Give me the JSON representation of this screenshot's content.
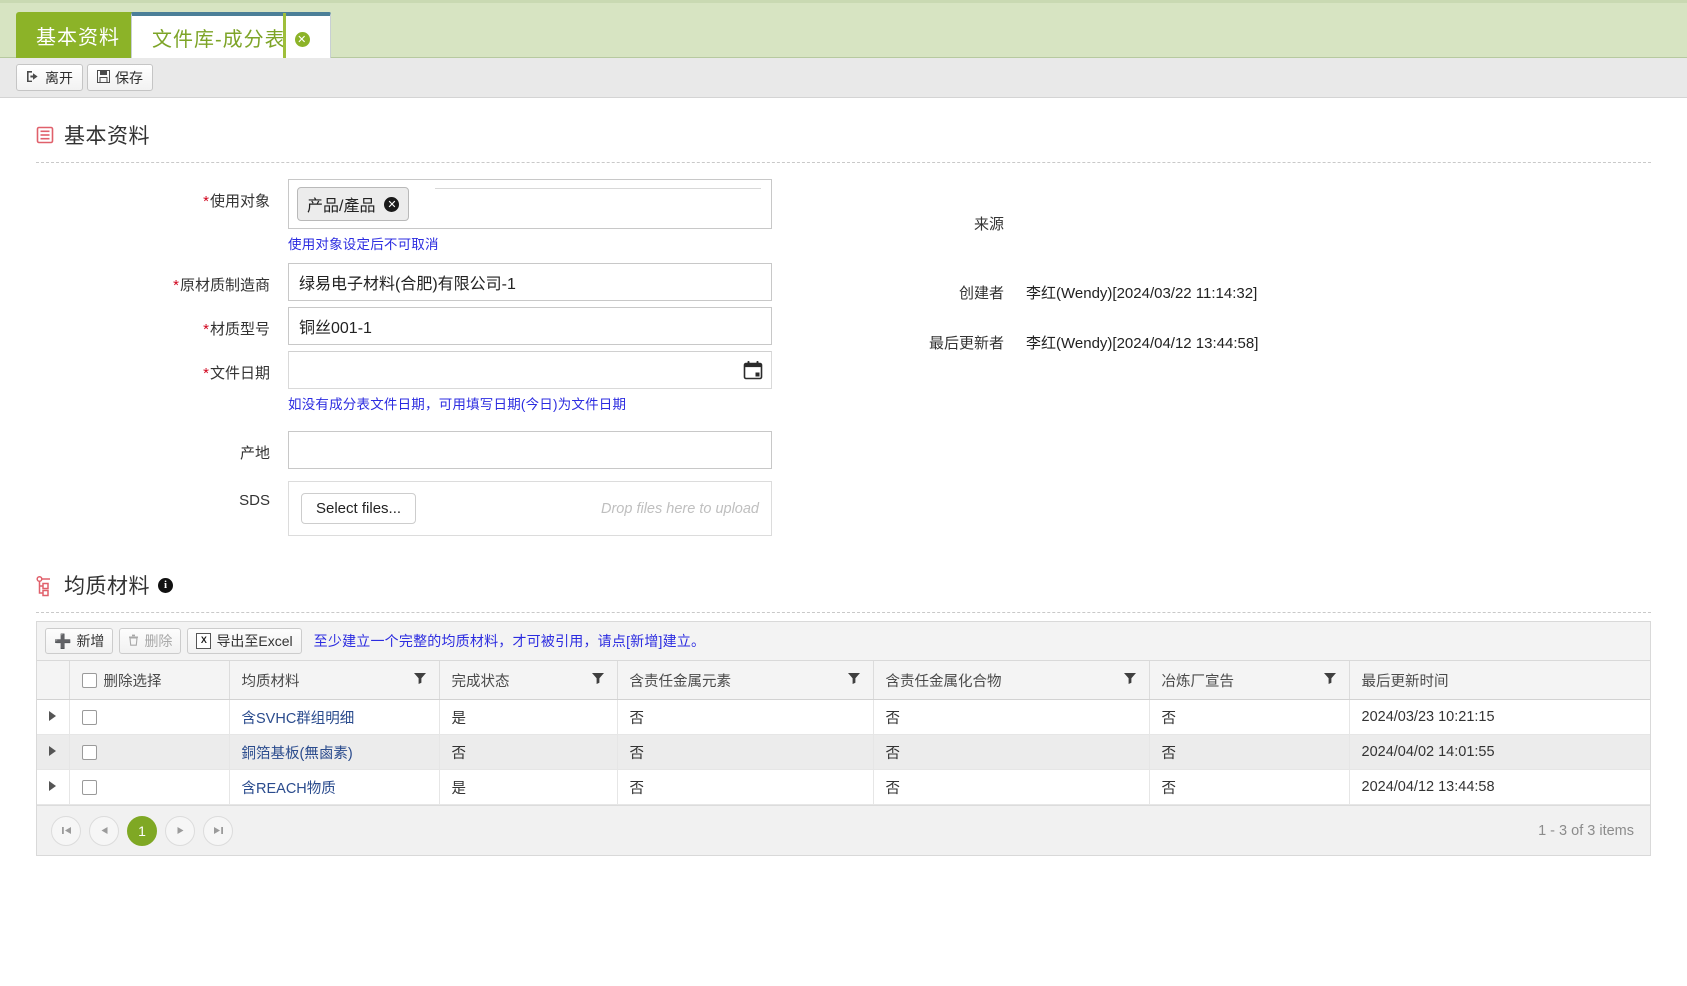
{
  "tabs": [
    {
      "label": "基本资料",
      "active": false,
      "closable": false
    },
    {
      "label": "文件库-成分表",
      "active": true,
      "closable": true,
      "close_glyph": "✖"
    }
  ],
  "toolbar": {
    "leave_label": "离开",
    "leave_icon": "➡",
    "save_label": "保存",
    "save_icon": "🖫"
  },
  "basic_section": {
    "title": "基本资料",
    "fields": {
      "usage_target": {
        "label": "使用对象",
        "required": true,
        "tag": "产品/產品",
        "tag_remove_glyph": "✕",
        "hint": "使用对象设定后不可取消"
      },
      "manufacturer": {
        "label": "原材质制造商",
        "required": true,
        "value": "绿易电子材料(合肥)有限公司-1"
      },
      "material_model": {
        "label": "材质型号",
        "required": true,
        "value": "铜丝001-1"
      },
      "file_date": {
        "label": "文件日期",
        "required": true,
        "value": "",
        "hint": "如没有成分表文件日期，可用填写日期(今日)为文件日期"
      },
      "origin": {
        "label": "产地",
        "value": ""
      },
      "sds": {
        "label": "SDS",
        "select_files_label": "Select files...",
        "drop_hint": "Drop files here to upload"
      }
    },
    "right_fields": [
      {
        "label": "来源",
        "value": ""
      },
      {
        "label": "创建者",
        "value": "李红(Wendy)[2024/03/22 11:14:32]"
      },
      {
        "label": "最后更新者",
        "value": "李红(Wendy)[2024/04/12 13:44:58]"
      }
    ]
  },
  "homogeneous_section": {
    "title": "均质材料",
    "info_glyph": "i",
    "grid_toolbar": {
      "add_label": "新增",
      "add_icon": "✚",
      "delete_label": "删除",
      "delete_icon": "🗑",
      "export_label": "导出至Excel",
      "export_icon": "X",
      "note": "至少建立一个完整的均质材料，才可被引用，请点[新增]建立。"
    },
    "columns": [
      {
        "key": "expand",
        "label": "",
        "filter": false
      },
      {
        "key": "select",
        "label": "删除选择",
        "filter": false
      },
      {
        "key": "material",
        "label": "均质材料",
        "filter": true
      },
      {
        "key": "status",
        "label": "完成状态",
        "filter": true
      },
      {
        "key": "metal_element",
        "label": "含责任金属元素",
        "filter": true
      },
      {
        "key": "metal_compound",
        "label": "含责任金属化合物",
        "filter": true
      },
      {
        "key": "smelter",
        "label": "冶炼厂宣告",
        "filter": true
      },
      {
        "key": "updated",
        "label": "最后更新时间",
        "filter": false
      }
    ],
    "rows": [
      {
        "material": "含SVHC群组明细",
        "status": "是",
        "metal_element": "否",
        "metal_compound": "否",
        "smelter": "否",
        "updated": "2024/03/23 10:21:15"
      },
      {
        "material": "銅箔基板(無鹵素)",
        "status": "否",
        "metal_element": "否",
        "metal_compound": "否",
        "smelter": "否",
        "updated": "2024/04/02 14:01:55"
      },
      {
        "material": "含REACH物质",
        "status": "是",
        "metal_element": "否",
        "metal_compound": "否",
        "smelter": "否",
        "updated": "2024/04/12 13:44:58"
      }
    ],
    "pager": {
      "first_glyph": "⏮",
      "prev_glyph": "◀",
      "current_page": "1",
      "next_glyph": "▶",
      "last_glyph": "⏭",
      "info": "1 - 3 of 3 items"
    }
  },
  "colors": {
    "tab_active_green": "#7da427",
    "tab_basic_bg": "#8cb328",
    "tabstrip_bg": "#d7e4c2",
    "tab_top_border": "#4b7f98",
    "section_icon_red": "#e0606b",
    "hint_blue": "#2c2ce0",
    "link_blue": "#2a4b8d",
    "pager_active": "#7fa824",
    "required_red": "#d0021b"
  }
}
